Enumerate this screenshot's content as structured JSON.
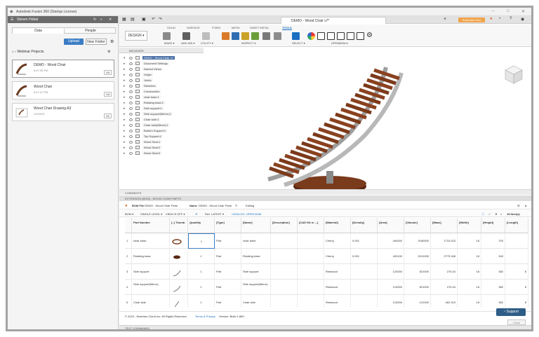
{
  "window": {
    "title": "Autodesk Fusion 360 (Startup License)"
  },
  "data_panel": {
    "user": "Steven Hobal",
    "tabs": [
      "Data",
      "People"
    ],
    "upload_label": "Upload",
    "new_folder_label": "New Folder",
    "breadcrumb": "Webinar Projects",
    "items": [
      {
        "name": "DEMO - Wood Chair",
        "date": "6:47:35 PM",
        "version": "V4"
      },
      {
        "name": "Wood Chair",
        "date": "6:47:47 PM",
        "version": "V4"
      },
      {
        "name": "Wood Chair Drawing A3",
        "date": "12/16/20",
        "version": "V1"
      }
    ]
  },
  "document": {
    "tab_title": "DEMO - Wood Chair v7*",
    "subscribe_label": "Subscribe Now"
  },
  "toolbar": {
    "workspace": "DESIGN ▾",
    "ribbon_tabs": [
      "SOLID",
      "SURFACE",
      "FORM",
      "MESH",
      "SHEET METAL",
      "TOOLS"
    ],
    "active_tab": "TOOLS",
    "groups": [
      "MAKE ▾",
      "ADD-INS ▾",
      "UTILITY ▾",
      "INSPECT ▾",
      "SELECT ▾",
      "OPENBOM ▾"
    ]
  },
  "browser": {
    "title": "BROWSER",
    "root": "DEMO - Wood Chair v7",
    "nodes": [
      "Document Settings",
      "Named Views",
      "Origin",
      "Joints",
      "Sketches",
      "Construction",
      "chair base:1",
      "Rotating base:1",
      "Side support:1",
      "Side support(Mirror):1",
      "Chair side:1",
      "Chair side(Mirror):1",
      "Bottom Support:1",
      "Top Support:1",
      "Wood Seat:1",
      "Wood Seat:2",
      "Wood Seat:3"
    ]
  },
  "comments_label": "COMMENTS",
  "bom": {
    "panel_title": "EXTENSION (BOM) - WOOD CHAIR PARTS",
    "bom_file_label": "BOM File",
    "bom_file_value": "DEMO - Wood Chair Parts",
    "name_label": "Name",
    "name_value": "DEMO - Wood Chair Parts",
    "editing": "Editing",
    "bom_label": "BOM ▾",
    "level": "SINGLE LEVEL ▾",
    "view": "VIEW IS OFF ▾",
    "rev": "Rev. LATEST ▾",
    "catalog": "CATALOG: OPEN BOM",
    "count": "15 Item(s)",
    "columns": [
      "",
      "Part Number",
      "[..] Thumb",
      "Quantity",
      "[Type]",
      "[Name]",
      "[Description]",
      "[CAD file in ...]",
      "[Material]",
      "[Density]",
      "[Area]",
      "[Volume]",
      "[Mass]",
      "[Width]",
      "[Height]",
      "[Length]"
    ],
    "rows": [
      [
        "1",
        "chair base",
        "",
        "1",
        "Part",
        "chair base",
        "",
        "",
        "Cherry",
        "0.001",
        "440000",
        "3180000",
        "1710.023",
        "18",
        "700",
        ""
      ],
      [
        "2",
        "Rotating base",
        "",
        "1",
        "Part",
        "Rotating base",
        "",
        "",
        "Cherry",
        "0.001",
        "400100",
        "3101000",
        "2775.348",
        "18",
        "340",
        ""
      ],
      [
        "3",
        "Side support",
        "",
        "1",
        "Part",
        "Side support",
        "",
        "",
        "Redwood",
        "",
        "124000",
        "821000",
        "276.34",
        "18",
        "382",
        "8"
      ],
      [
        "4",
        "Side support(Mirror)",
        "",
        "1",
        "Part",
        "Side support(Mirror)",
        "",
        "",
        "Redwood",
        "",
        "124000",
        "821000",
        "276.34",
        "18",
        "382",
        "8"
      ],
      [
        "5",
        "Chair side",
        "",
        "1",
        "Part",
        "Chair side",
        "",
        "",
        "Redwood",
        "",
        "124000",
        "121000",
        "462.319",
        "18",
        "382",
        "8"
      ]
    ]
  },
  "footer": {
    "copyright": "© 2020 - Newmen Cloud Inc. All Rights Reserved.",
    "terms": "Terms & Privacy",
    "version": "Version: Build 1.869"
  },
  "support_label": "Support",
  "close_label": "Close",
  "text_commands": "TEXT COMMANDS"
}
